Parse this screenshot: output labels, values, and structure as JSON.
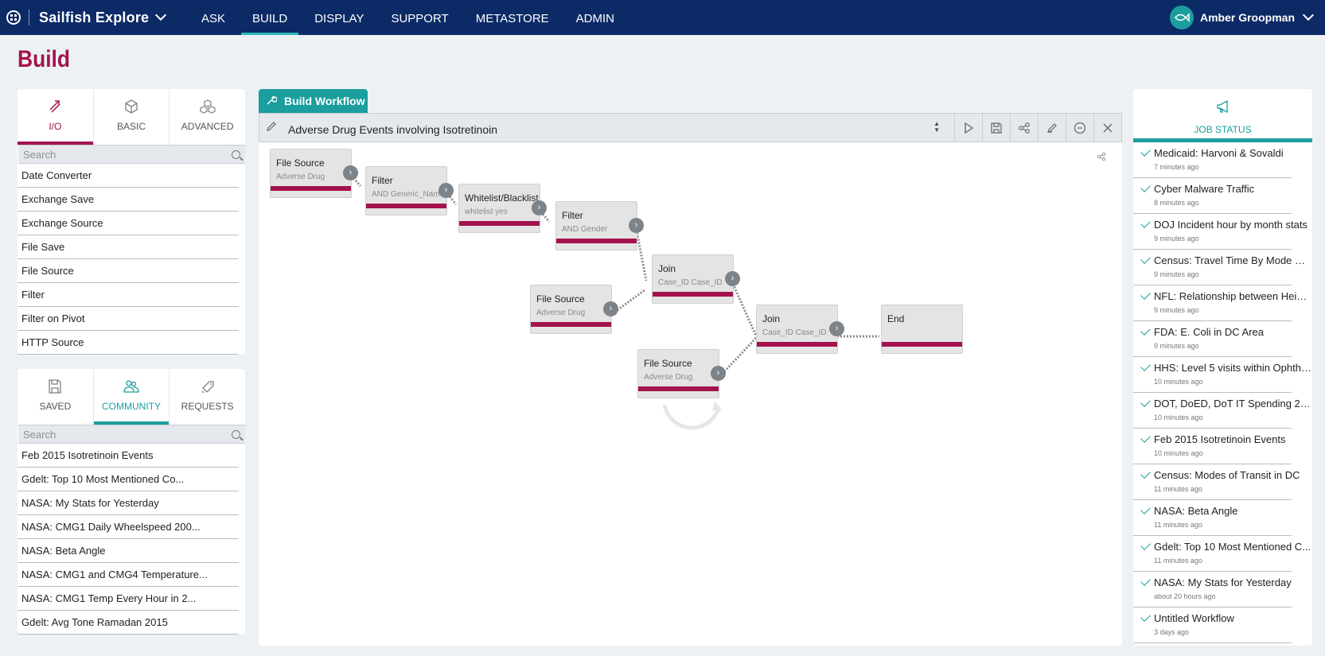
{
  "app": {
    "title": "Sailfish Explore"
  },
  "nav": [
    {
      "label": "ASK"
    },
    {
      "label": "BUILD",
      "active": true
    },
    {
      "label": "DISPLAY"
    },
    {
      "label": "SUPPORT"
    },
    {
      "label": "METASTORE"
    },
    {
      "label": "ADMIN"
    }
  ],
  "user": {
    "name": "Amber Groopman",
    "avatar_icon": "fish-icon"
  },
  "page": {
    "title": "Build"
  },
  "components_panel": {
    "tabs": [
      {
        "label": "I/O",
        "icon": "io-icon",
        "active": true
      },
      {
        "label": "BASIC",
        "icon": "cube-icon"
      },
      {
        "label": "ADVANCED",
        "icon": "cubes-icon"
      }
    ],
    "search_placeholder": "Search",
    "items": [
      "Date Converter",
      "Exchange Save",
      "Exchange Source",
      "File Save",
      "File Source",
      "Filter",
      "Filter on Pivot",
      "HTTP Source"
    ]
  },
  "workflows_panel": {
    "tabs": [
      {
        "label": "SAVED",
        "icon": "save-icon"
      },
      {
        "label": "COMMUNITY",
        "icon": "users-icon",
        "active": true
      },
      {
        "label": "REQUESTS",
        "icon": "tag-icon"
      }
    ],
    "search_placeholder": "Search",
    "items": [
      "Feb 2015 Isotretinoin Events",
      "Gdelt: Top 10 Most Mentioned Co...",
      "NASA: My Stats for Yesterday",
      "NASA: CMG1 Daily Wheelspeed 200...",
      "NASA: Beta Angle",
      "NASA: CMG1 and CMG4 Temperature...",
      "NASA: CMG1 Temp Every Hour in 2...",
      "Gdelt: Avg Tone Ramadan 2015"
    ]
  },
  "workflow": {
    "tab_label": "Build Workflow",
    "name": "Adverse Drug Events involving Isotretinoin",
    "toolbar_icons": [
      "run-icon",
      "save-icon",
      "share-icon",
      "edit-icon",
      "minus-icon",
      "close-icon"
    ],
    "nodes": [
      {
        "title": "File Source",
        "subtitle": "Adverse Drug"
      },
      {
        "title": "Filter",
        "subtitle": "AND Generic_Name"
      },
      {
        "title": "Whitelist/Blacklist",
        "subtitle": "whitelist yes"
      },
      {
        "title": "Filter",
        "subtitle": "AND Gender"
      },
      {
        "title": "Join",
        "subtitle": "Case_ID Case_ID"
      },
      {
        "title": "File Source",
        "subtitle": "Adverse Drug"
      },
      {
        "title": "Join",
        "subtitle": "Case_ID Case_ID"
      },
      {
        "title": "End",
        "subtitle": ""
      },
      {
        "title": "File Source",
        "subtitle": "Adverse Drug"
      }
    ]
  },
  "job_status": {
    "title": "JOB STATUS",
    "icon": "megaphone-icon",
    "items": [
      {
        "name": "Medicaid: Harvoni & Sovaldi",
        "time": "7 minutes ago"
      },
      {
        "name": "Cyber Malware Traffic",
        "time": "8 minutes ago"
      },
      {
        "name": "DOJ Incident hour by month stats",
        "time": "9 minutes ago"
      },
      {
        "name": "Census: Travel Time By Mode & I...",
        "time": "9 minutes ago"
      },
      {
        "name": "NFL: Relationship between Heigh...",
        "time": "9 minutes ago"
      },
      {
        "name": "FDA: E. Coli in DC Area",
        "time": "9 minutes ago"
      },
      {
        "name": "HHS: Level 5 visits within Ophtha...",
        "time": "10 minutes ago"
      },
      {
        "name": "DOT, DoED, DoT IT Spending 201...",
        "time": "10 minutes ago"
      },
      {
        "name": "Feb 2015 Isotretinoin Events",
        "time": "10 minutes ago"
      },
      {
        "name": "Census: Modes of Transit in DC",
        "time": "11 minutes ago"
      },
      {
        "name": "NASA: Beta Angle",
        "time": "11 minutes ago"
      },
      {
        "name": "Gdelt: Top 10 Most Mentioned C...",
        "time": "11 minutes ago"
      },
      {
        "name": "NASA: My Stats for Yesterday",
        "time": "about 20 hours ago"
      },
      {
        "name": "Untitled Workflow",
        "time": "3 days ago"
      }
    ]
  },
  "colors": {
    "brand": "#0b2a66",
    "accent": "#a4124e",
    "teal": "#1c9e9e"
  }
}
